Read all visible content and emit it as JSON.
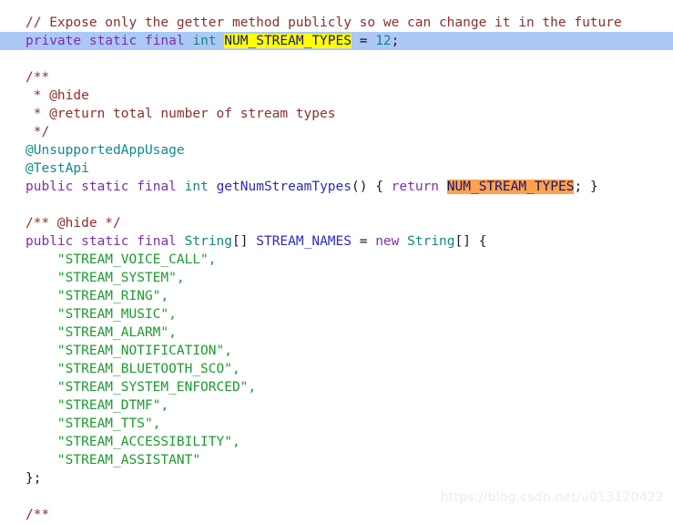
{
  "editor": {
    "background": "#ffffff",
    "selection_color": "#abc8f7",
    "highlight_yellow": "#ffff00",
    "highlight_orange": "#ffa24d",
    "font_size_px": 14.5,
    "line_height_px": 20
  },
  "colors": {
    "comment": "#8c2f2b",
    "keyword": "#7d2fa8",
    "type": "#0f8a7a",
    "identifier": "#2a2ac8",
    "string": "#1d9b2e",
    "number": "#0f8a7a",
    "annotation": "#0f8a8a",
    "plain": "#1a1a1a",
    "watermark": "#ececec"
  },
  "code": {
    "line_01_comment": "// Expose only the getter method publicly so we can change it in the future",
    "line_02": {
      "kw_private": "private",
      "kw_static": "static",
      "kw_final": "final",
      "type_int": "int",
      "name": "NUM_STREAM_TYPES",
      "assign": "=",
      "value": "12",
      "semicolon": ";"
    },
    "line_04_javadoc_open": "/**",
    "line_05_javadoc_hide": " * @hide",
    "line_06_javadoc_return": " * @return total number of stream types",
    "line_07_javadoc_close": " */",
    "line_08_annotation": "@UnsupportedAppUsage",
    "line_09_annotation": "@TestApi",
    "line_10": {
      "kw_public": "public",
      "kw_static": "static",
      "kw_final": "final",
      "type_int": "int",
      "method": "getNumStreamTypes",
      "parens": "()",
      "brace_open": "{",
      "kw_return": "return",
      "name": "NUM_STREAM_TYPES",
      "semicolon": ";",
      "brace_close": "}"
    },
    "line_12_javadoc_inline": "/** @hide */",
    "line_13": {
      "kw_public": "public",
      "kw_static": "static",
      "kw_final": "final",
      "type_String": "String",
      "brackets": "[]",
      "name": "STREAM_NAMES",
      "assign": "=",
      "kw_new": "new",
      "type_String2": "String",
      "brackets2": "[]",
      "brace_open": "{"
    },
    "stream_names": [
      "\"STREAM_VOICE_CALL\",",
      "\"STREAM_SYSTEM\",",
      "\"STREAM_RING\",",
      "\"STREAM_MUSIC\",",
      "\"STREAM_ALARM\",",
      "\"STREAM_NOTIFICATION\",",
      "\"STREAM_BLUETOOTH_SCO\",",
      "\"STREAM_SYSTEM_ENFORCED\",",
      "\"STREAM_DTMF\",",
      "\"STREAM_TTS\",",
      "\"STREAM_ACCESSIBILITY\",",
      "\"STREAM_ASSISTANT\""
    ],
    "line_close_array": "};",
    "line_last_javadoc_open": "/**"
  },
  "watermark": {
    "text": "https://blog.csdn.net/u013120422"
  }
}
